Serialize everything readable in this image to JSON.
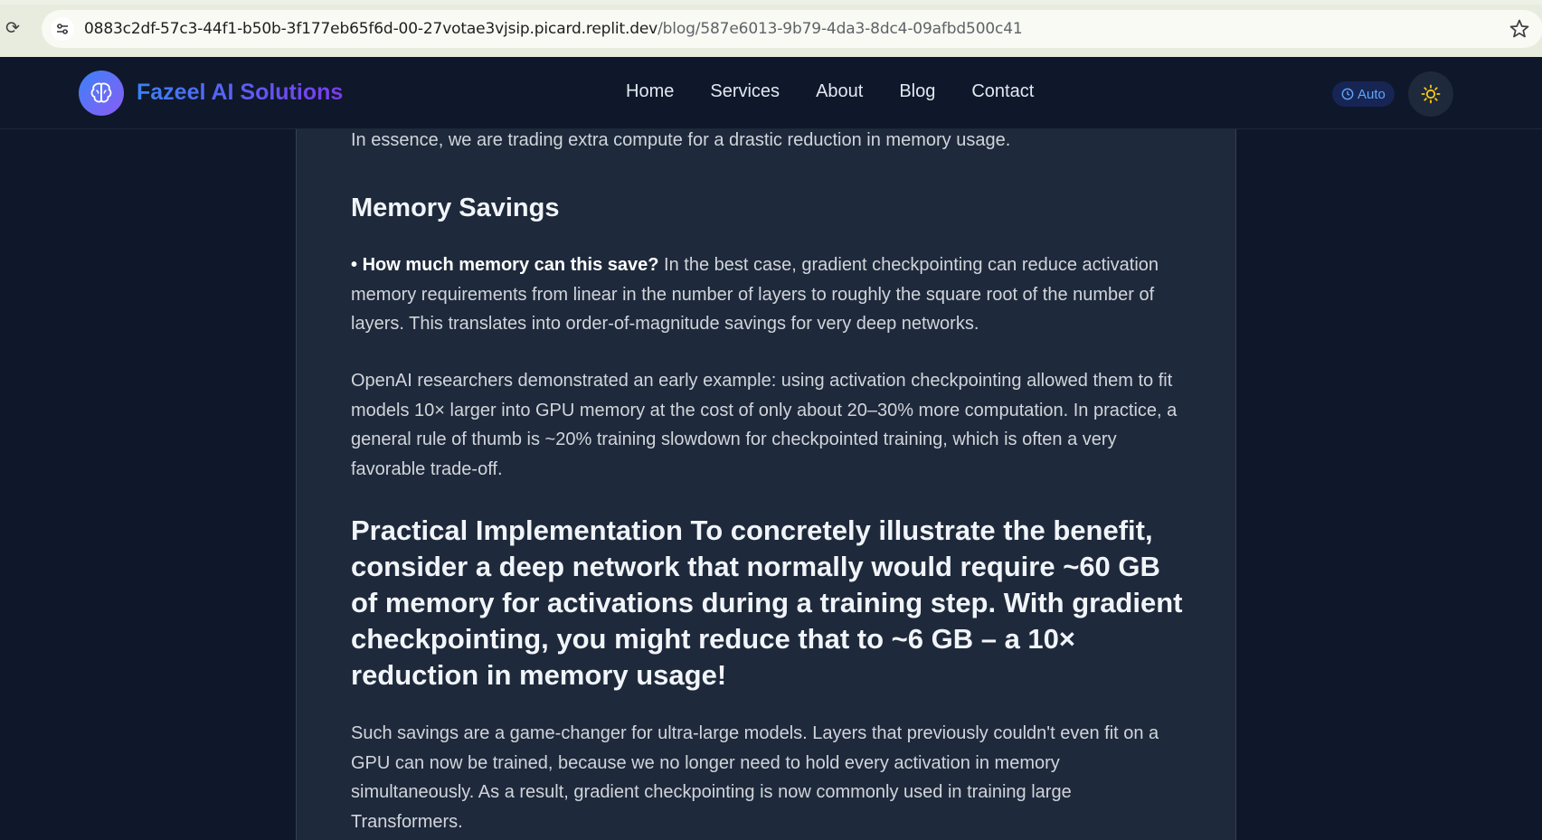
{
  "browser": {
    "reload_icon": "reload-icon",
    "url_host": "0883c2df-57c3-44f1-b50b-3f177eb65f6d-00-27votae3vjsip.picard.replit.dev",
    "url_path": "/blog/587e6013-9b79-4da3-8dc4-09afbd500c41",
    "site_info_icon": "tune-icon",
    "bookmark_icon": "star-icon"
  },
  "nav": {
    "brand": "Fazeel AI Solutions",
    "logo_icon": "brain-icon",
    "links": [
      "Home",
      "Services",
      "About",
      "Blog",
      "Contact"
    ],
    "auto_label": "Auto",
    "auto_icon": "clock-icon",
    "theme_icon": "sun-icon",
    "accent_color": "#6366f1"
  },
  "article": {
    "intro_end": "In essence, we are trading extra compute for a drastic reduction in memory usage.",
    "section_memory_title": "Memory Savings",
    "bullet_symbol": "•",
    "bullet_bold": "How much memory can this save?",
    "bullet_text": " In the best case, gradient checkpointing can reduce activation memory requirements from linear in the number of layers to roughly the square root of the number of layers. This translates into order-of-magnitude savings for very deep networks.",
    "openai_para": "OpenAI researchers demonstrated an early example: using activation checkpointing allowed them to fit models 10× larger into GPU memory at the cost of only about 20–30% more computation. In practice, a general rule of thumb is ~20% training slowdown for checkpointed training, which is often a very favorable trade-off.",
    "practical_heading": "Practical Implementation To concretely illustrate the benefit, consider a deep network that normally would require ~60 GB of memory for activations during a training step. With gradient checkpointing, you might reduce that to ~6 GB – a 10× reduction in memory usage!",
    "savings_para": "Such savings are a game-changer for ultra-large models. Layers that previously couldn't even fit on a GPU can now be trained, because we no longer need to hold every activation in memory simultaneously. As a result, gradient checkpointing is now commonly used in training large Transformers."
  }
}
